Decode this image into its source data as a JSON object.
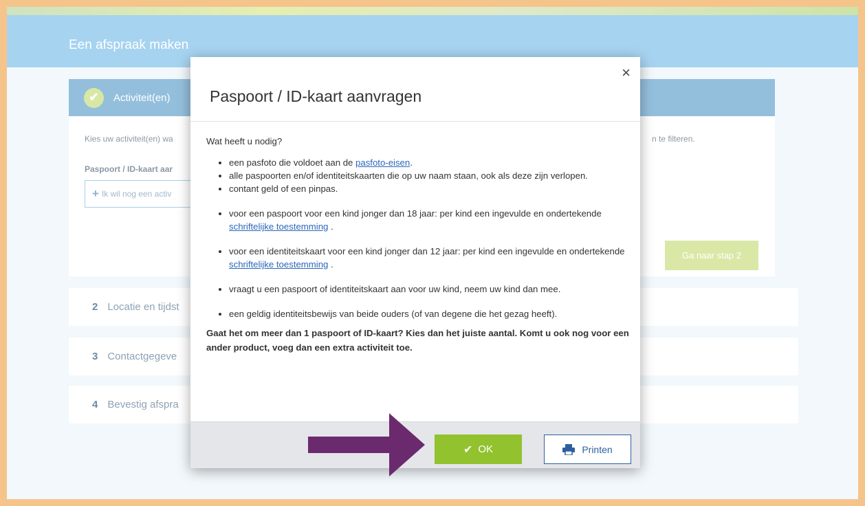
{
  "header": {
    "title": "Een afspraak maken"
  },
  "step1": {
    "title": "Activiteit(en)",
    "intro": "Kies uw activiteit(en) wa",
    "intro_tail": "n te filteren.",
    "activity_label": "Paspoort / ID-kaart aar",
    "add_button_label": "Ik wil nog een activ",
    "next_button_label": "Ga naar stap 2"
  },
  "steps": [
    {
      "number": "2",
      "label": "Locatie en tijdst"
    },
    {
      "number": "3",
      "label": "Contactgegeve"
    },
    {
      "number": "4",
      "label": "Bevestig afspra"
    }
  ],
  "modal": {
    "close_label": "×",
    "title": "Paspoort / ID-kaart aanvragen",
    "question": "Wat heeft u nodig?",
    "items1": [
      {
        "text": "een pasfoto die voldoet aan de ",
        "link": "pasfoto-eisen",
        "after": "."
      },
      {
        "text": "alle paspoorten en/of identiteitskaarten die op uw naam staan, ook als deze zijn verlopen."
      },
      {
        "text": "contant geld of een pinpas."
      }
    ],
    "items2": [
      {
        "text": "voor een paspoort voor een kind jonger dan 18 jaar: per kind een ingevulde en ondertekende ",
        "link": "schriftelijke toestemming",
        "after": " ."
      },
      {
        "text": "voor een identiteitskaart voor een kind jonger dan 12 jaar: per kind een ingevulde en ondertekende ",
        "link": "schriftelijke toestemming",
        "after": " ."
      },
      {
        "text": "vraagt u een paspoort of identiteitskaart aan voor uw kind, neem uw kind dan mee."
      },
      {
        "text": "een geldig identiteitsbewijs van beide ouders (of van degene die het gezag heeft)."
      }
    ],
    "note": "Gaat het om meer dan 1 paspoort of ID-kaart? Kies dan het juiste aantal. Komt u ook nog voor een ander product, voeg dan een extra activiteit toe.",
    "ok_label": "OK",
    "print_label": "Printen"
  },
  "colors": {
    "accent_green": "#92c22e",
    "header_blue": "#a6d3f0",
    "arrow_purple": "#6b2a6e",
    "frame_orange": "#f5c48b"
  },
  "icons": [
    "check-icon",
    "plus-icon",
    "close-icon",
    "printer-icon",
    "arrow-annotation"
  ]
}
